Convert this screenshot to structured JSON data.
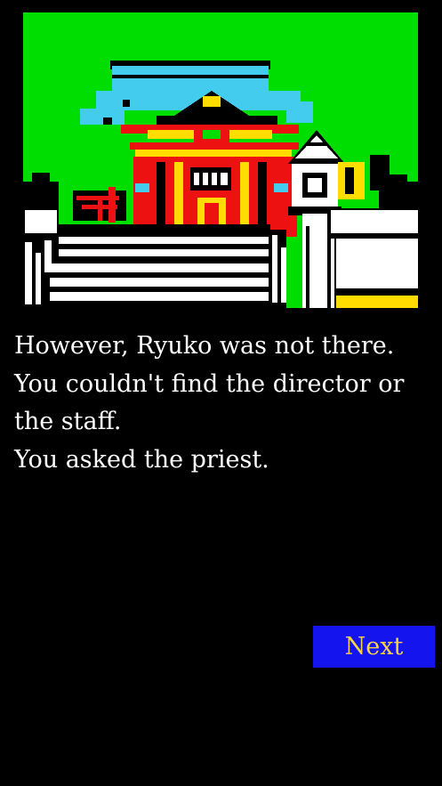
{
  "scene": {
    "icon": "shrine-pixel-art"
  },
  "story": {
    "lines": [
      "However, Ryuko was not there.",
      "You couldn't find the director or",
      "the staff.",
      "You asked the priest."
    ]
  },
  "next_label": "Next",
  "colors": {
    "background": "#000000",
    "sky": "#00dd00",
    "roof": "#44ccee",
    "shrine_red": "#ee1111",
    "shrine_yellow": "#ffdd00",
    "button_bg": "#1414ee",
    "button_text": "#f6d24a"
  }
}
